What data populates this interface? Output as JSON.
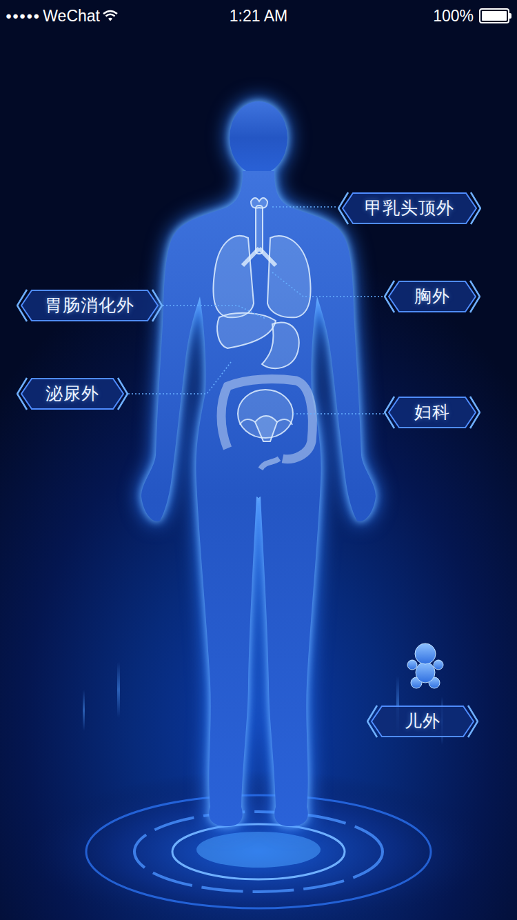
{
  "status_bar": {
    "signal": "●●●●●",
    "carrier": "WeChat",
    "time": "1:21 AM",
    "battery_text": "100%",
    "battery_level": 1
  },
  "tags": [
    {
      "label": "甲乳头顶外"
    },
    {
      "label": "胸外"
    },
    {
      "label": "胃肠消化外"
    },
    {
      "label": "泌尿外"
    },
    {
      "label": "妇科"
    },
    {
      "label": "儿外"
    }
  ]
}
